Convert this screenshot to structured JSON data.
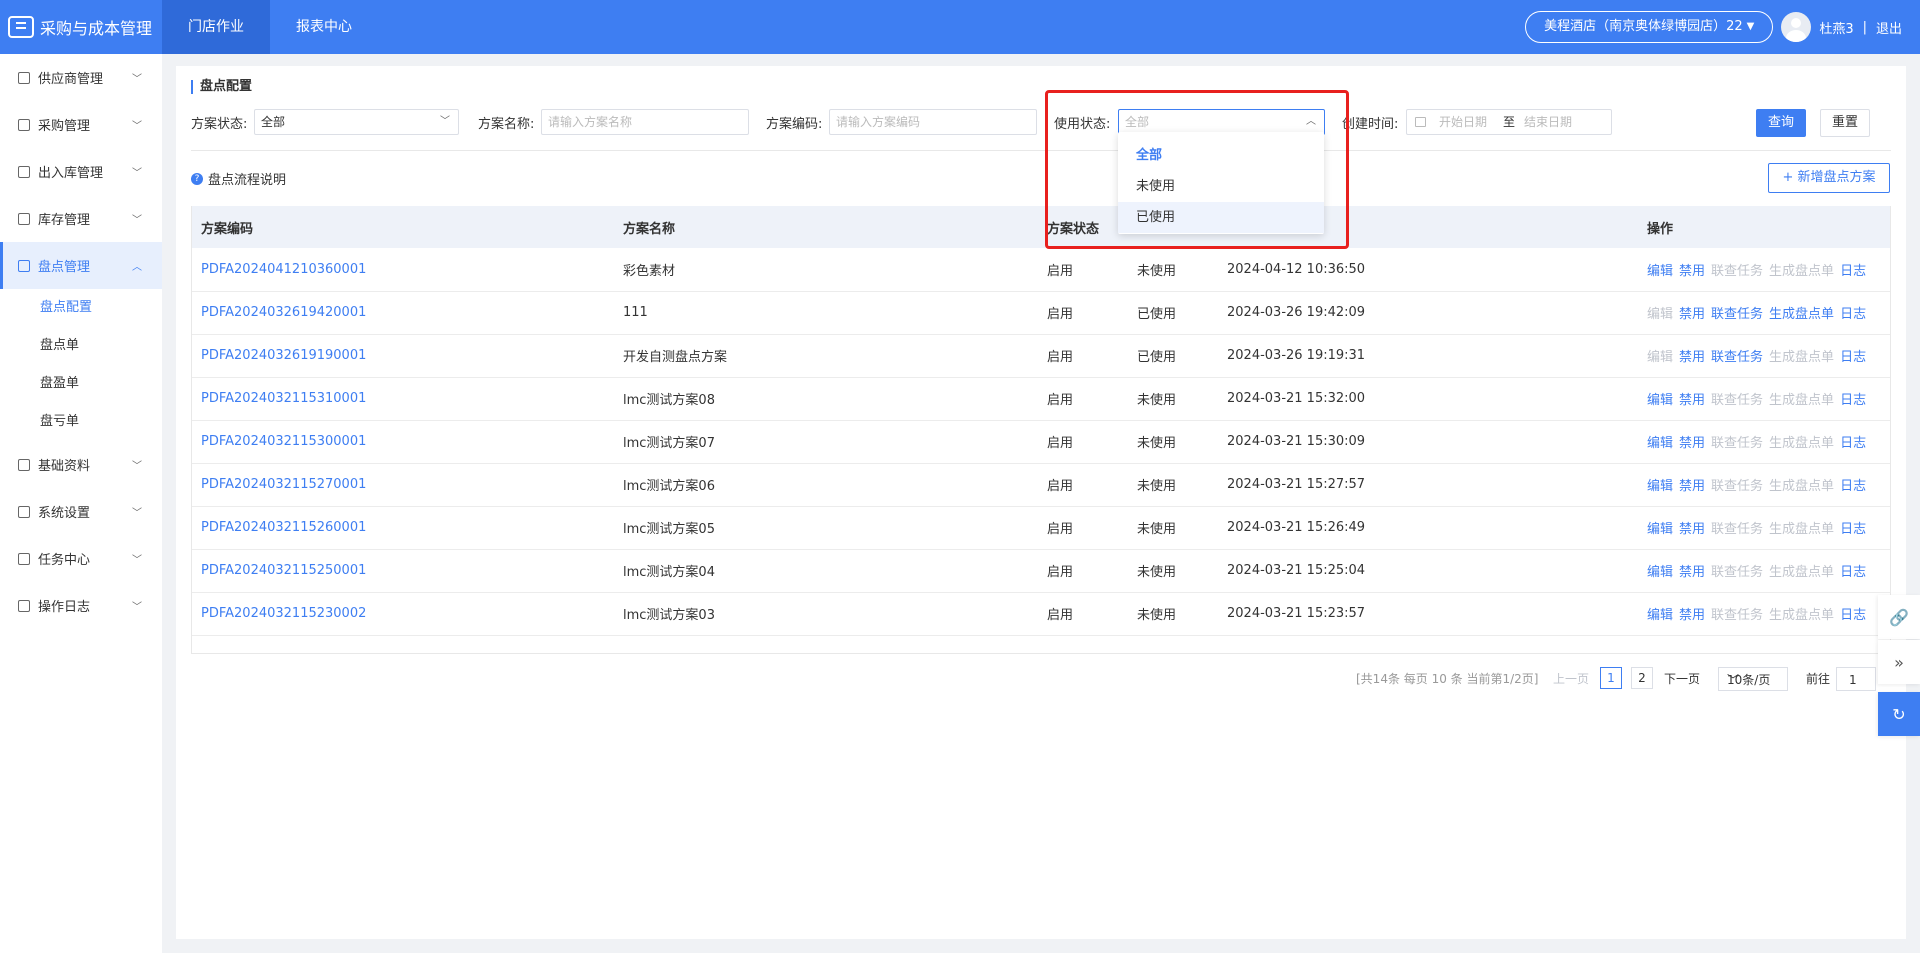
{
  "app": {
    "title": "采购与成本管理"
  },
  "topnav": [
    {
      "label": "门店作业",
      "active": true
    },
    {
      "label": "报表中心",
      "active": false
    }
  ],
  "header": {
    "store": "美程酒店（南京奥体绿博园店）22",
    "user": "杜燕3",
    "separator": "|",
    "logout": "退出"
  },
  "sidebar": {
    "items": [
      {
        "label": "供应商管理",
        "icon": "supplier-icon"
      },
      {
        "label": "采购管理",
        "icon": "purchase-icon"
      },
      {
        "label": "出入库管理",
        "icon": "stock-io-icon"
      },
      {
        "label": "库存管理",
        "icon": "inventory-icon"
      },
      {
        "label": "盘点管理",
        "icon": "stocktake-icon",
        "active": true
      },
      {
        "label": "基础资料",
        "icon": "basic-data-icon"
      },
      {
        "label": "系统设置",
        "icon": "settings-icon"
      },
      {
        "label": "任务中心",
        "icon": "task-icon"
      },
      {
        "label": "操作日志",
        "icon": "log-icon"
      }
    ],
    "subitems": [
      {
        "label": "盘点配置",
        "active": true
      },
      {
        "label": "盘点单"
      },
      {
        "label": "盘盈单"
      },
      {
        "label": "盘亏单"
      }
    ]
  },
  "page": {
    "title": "盘点配置",
    "filters": {
      "status_label": "方案状态:",
      "status_value": "全部",
      "name_label": "方案名称:",
      "name_placeholder": "请输入方案名称",
      "code_label": "方案编码:",
      "code_placeholder": "请输入方案编码",
      "usage_label": "使用状态:",
      "usage_placeholder": "全部",
      "created_label": "创建时间:",
      "start_placeholder": "开始日期",
      "date_sep": "至",
      "end_placeholder": "结束日期",
      "query_button": "查询",
      "reset_button": "重置"
    },
    "help_text": "盘点流程说明",
    "add_button": "+ 新增盘点方案"
  },
  "usage_dropdown": {
    "options": [
      "全部",
      "未使用",
      "已使用"
    ],
    "selected": "全部",
    "hovered": "已使用"
  },
  "table": {
    "columns": [
      "方案编码",
      "方案名称",
      "方案状态",
      "",
      "",
      "操作"
    ],
    "actions": [
      "编辑",
      "禁用",
      "联查任务",
      "生成盘点单",
      "日志"
    ],
    "rows": [
      {
        "code": "PDFA2024041210360001",
        "name": "彩色素材",
        "status": "启用",
        "usage": "未使用",
        "created": "2024-04-12 10:36:50",
        "edit_enabled": true,
        "link_enabled": false,
        "gen_enabled": false
      },
      {
        "code": "PDFA2024032619420001",
        "name": "111",
        "status": "启用",
        "usage": "已使用",
        "created": "2024-03-26 19:42:09",
        "edit_enabled": false,
        "link_enabled": true,
        "gen_enabled": true
      },
      {
        "code": "PDFA2024032619190001",
        "name": "开发自测盘点方案",
        "status": "启用",
        "usage": "已使用",
        "created": "2024-03-26 19:19:31",
        "edit_enabled": false,
        "link_enabled": true,
        "gen_enabled": false
      },
      {
        "code": "PDFA2024032115310001",
        "name": "lmc测试方案08",
        "status": "启用",
        "usage": "未使用",
        "created": "2024-03-21 15:32:00",
        "edit_enabled": true,
        "link_enabled": false,
        "gen_enabled": false
      },
      {
        "code": "PDFA2024032115300001",
        "name": "lmc测试方案07",
        "status": "启用",
        "usage": "未使用",
        "created": "2024-03-21 15:30:09",
        "edit_enabled": true,
        "link_enabled": false,
        "gen_enabled": false
      },
      {
        "code": "PDFA2024032115270001",
        "name": "lmc测试方案06",
        "status": "启用",
        "usage": "未使用",
        "created": "2024-03-21 15:27:57",
        "edit_enabled": true,
        "link_enabled": false,
        "gen_enabled": false
      },
      {
        "code": "PDFA2024032115260001",
        "name": "lmc测试方案05",
        "status": "启用",
        "usage": "未使用",
        "created": "2024-03-21 15:26:49",
        "edit_enabled": true,
        "link_enabled": false,
        "gen_enabled": false
      },
      {
        "code": "PDFA2024032115250001",
        "name": "lmc测试方案04",
        "status": "启用",
        "usage": "未使用",
        "created": "2024-03-21 15:25:04",
        "edit_enabled": true,
        "link_enabled": false,
        "gen_enabled": false
      },
      {
        "code": "PDFA2024032115230002",
        "name": "lmc测试方案03",
        "status": "启用",
        "usage": "未使用",
        "created": "2024-03-21 15:23:57",
        "edit_enabled": true,
        "link_enabled": false,
        "gen_enabled": false
      }
    ]
  },
  "pagination": {
    "info": "[共14条 每页 10 条 当前第1/2页]",
    "prev": "上一页",
    "pages": [
      "1",
      "2"
    ],
    "current": "1",
    "next": "下一页",
    "page_size": "10条/页",
    "goto_label": "前往",
    "goto_value": "1"
  },
  "float_tools": [
    "link-icon",
    "collapse-icon",
    "support-icon"
  ],
  "colors": {
    "primary": "#3e7ef2",
    "highlight": "#e8201e",
    "disabled": "#c0c4cc"
  }
}
